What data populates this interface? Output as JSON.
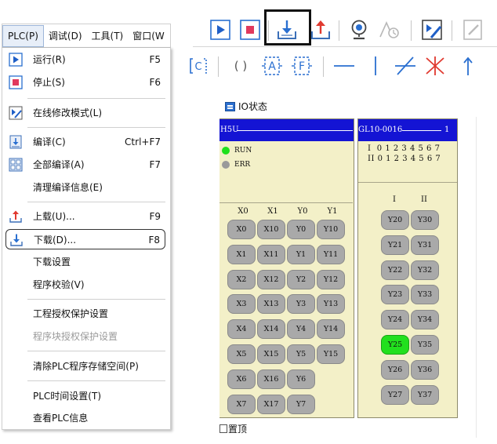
{
  "menubar": {
    "items": [
      "PLC(P)",
      "调试(D)",
      "工具(T)",
      "窗口(W"
    ]
  },
  "plc_menu": {
    "items": [
      {
        "label": "运行(R)",
        "shortcut": "F5",
        "icon": "run-icon",
        "disabled": false
      },
      {
        "label": "停止(S)",
        "shortcut": "F6",
        "icon": "stop-icon",
        "disabled": false
      },
      {
        "label": "在线修改模式(L)",
        "shortcut": "",
        "icon": "online-edit-icon",
        "disabled": false
      },
      {
        "label": "编译(C)",
        "shortcut": "Ctrl+F7",
        "icon": "compile-icon",
        "disabled": false
      },
      {
        "label": "全部编译(A)",
        "shortcut": "F7",
        "icon": "compile-all-icon",
        "disabled": false
      },
      {
        "label": "清理编译信息(E)",
        "shortcut": "",
        "icon": "",
        "disabled": false
      },
      {
        "label": "上载(U)...",
        "shortcut": "F9",
        "icon": "upload-icon",
        "disabled": false
      },
      {
        "label": "下载(D)...",
        "shortcut": "F8",
        "icon": "download-icon",
        "disabled": false,
        "highlighted": true
      },
      {
        "label": "下载设置",
        "shortcut": "",
        "icon": "",
        "disabled": false
      },
      {
        "label": "程序校验(V)",
        "shortcut": "",
        "icon": "",
        "disabled": false
      },
      {
        "label": "工程授权保护设置",
        "shortcut": "",
        "icon": "",
        "disabled": false
      },
      {
        "label": "程序块授权保护设置",
        "shortcut": "",
        "icon": "",
        "disabled": true
      },
      {
        "label": "清除PLC程序存储空间(P)",
        "shortcut": "",
        "icon": "",
        "disabled": false
      },
      {
        "label": "PLC时间设置(T)",
        "shortcut": "",
        "icon": "",
        "disabled": false
      },
      {
        "label": "查看PLC信息",
        "shortcut": "",
        "icon": "",
        "disabled": false
      }
    ]
  },
  "toolbar": {
    "row1": [
      "run-icon",
      "stop-icon",
      "download-icon",
      "upload-icon",
      "monitor-webcam-icon",
      "timer-icon",
      "online-edit-icon",
      "edit-doc-icon"
    ],
    "row2_labels": {
      "coil": "C",
      "func": "( )",
      "a": "A",
      "f": "F"
    }
  },
  "io_window": {
    "title": "IO状态",
    "left_panel": {
      "header": "H5U",
      "status": [
        {
          "label": "RUN",
          "color": "#1fe01c"
        },
        {
          "label": "ERR",
          "color": "#9a9a9a"
        }
      ],
      "col_headers": [
        "X0",
        "X1",
        "Y0",
        "Y1"
      ],
      "rows": [
        [
          "X0",
          "X10",
          "Y0",
          "Y10"
        ],
        [
          "X1",
          "X11",
          "Y1",
          "Y11"
        ],
        [
          "X2",
          "X12",
          "Y2",
          "Y12"
        ],
        [
          "X3",
          "X13",
          "Y3",
          "Y13"
        ],
        [
          "X4",
          "X14",
          "Y4",
          "Y14"
        ],
        [
          "X5",
          "X15",
          "Y5",
          "Y15"
        ],
        [
          "X6",
          "X16",
          "Y6",
          ""
        ],
        [
          "X7",
          "X17",
          "Y7",
          ""
        ]
      ]
    },
    "right_panel": {
      "header": "GL10-0016",
      "slot": "1",
      "row_i": "I  0 1 2 3 4 5 6 7",
      "row_ii": "II 0 1 2 3 4 5 6 7",
      "col_headers": [
        "I",
        "II"
      ],
      "rows": [
        [
          "Y20",
          "Y30"
        ],
        [
          "Y21",
          "Y31"
        ],
        [
          "Y22",
          "Y32"
        ],
        [
          "Y23",
          "Y33"
        ],
        [
          "Y24",
          "Y34"
        ],
        [
          "Y25",
          "Y35"
        ],
        [
          "Y26",
          "Y36"
        ],
        [
          "Y27",
          "Y37"
        ]
      ],
      "active": [
        "Y25"
      ]
    },
    "topmost_label": "置顶",
    "colors": {
      "panel_bg": "#f3f0c8",
      "header_bg": "#1414d4",
      "io_off": "#a9a9a9",
      "io_on": "#22e01e"
    }
  }
}
